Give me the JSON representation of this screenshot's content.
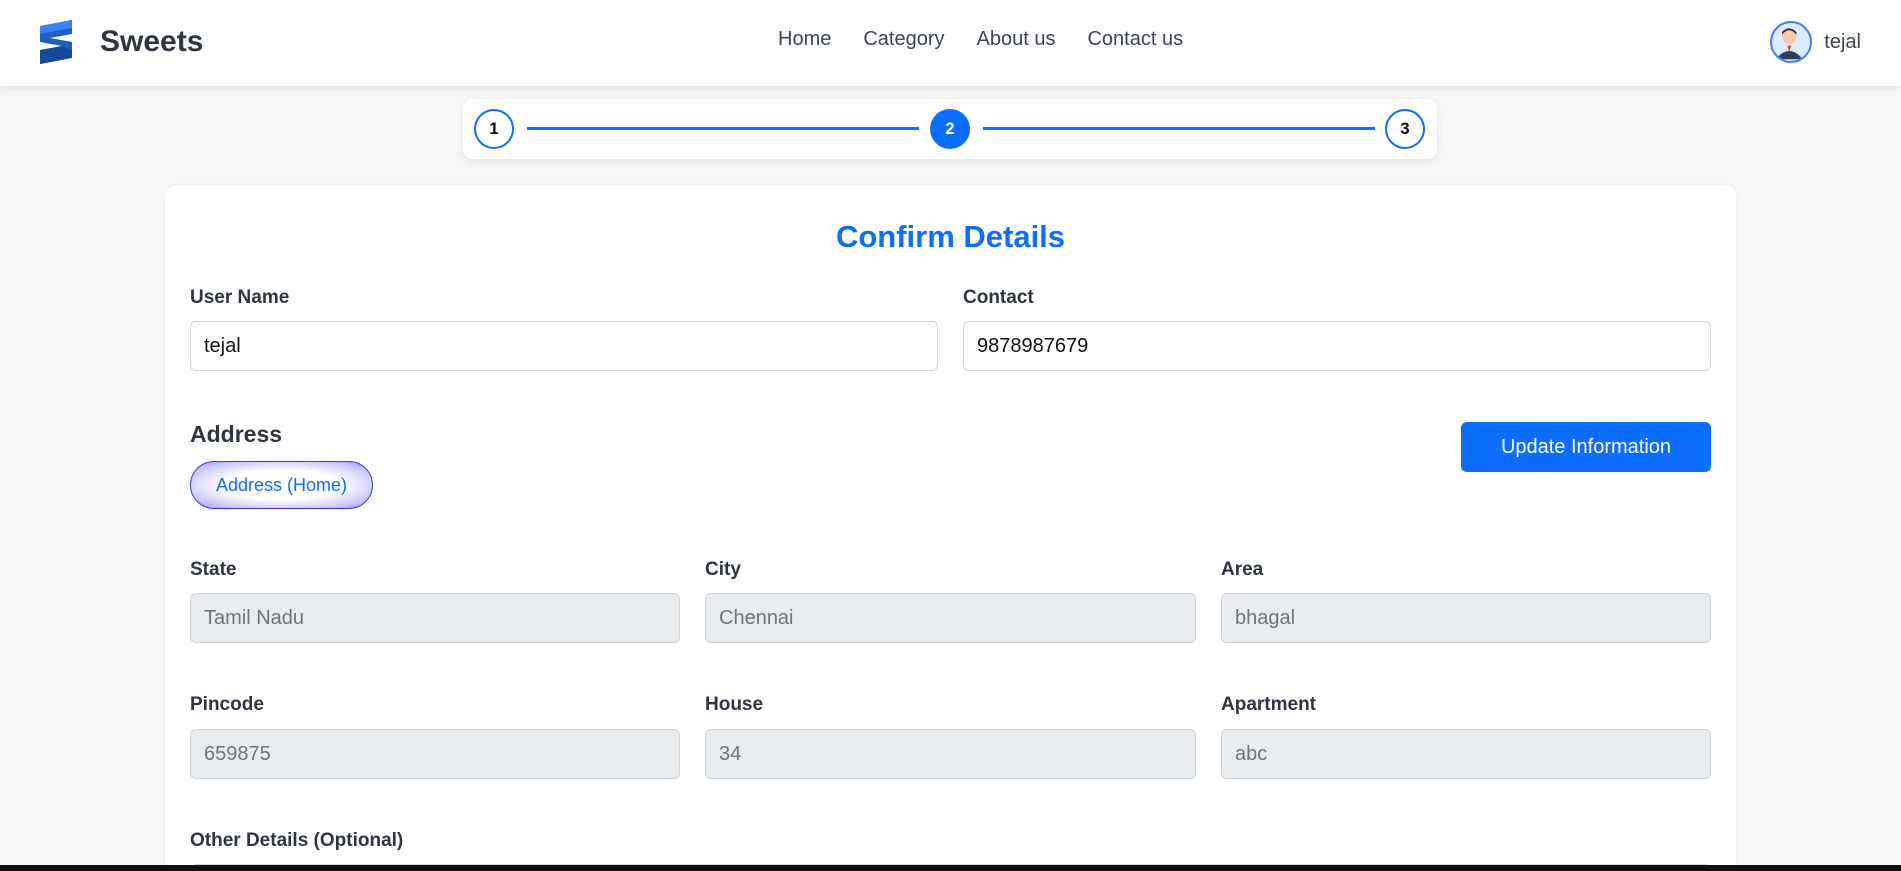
{
  "navbar": {
    "brand_name": "Sweets",
    "links": [
      "Home",
      "Category",
      "About us",
      "Contact us"
    ],
    "user_name": "tejal"
  },
  "stepper": {
    "steps": [
      "1",
      "2",
      "3"
    ],
    "active_step": 2,
    "accent": "#0d6efd"
  },
  "form": {
    "title": "Confirm Details",
    "user_name_label": "User Name",
    "user_name_value": "tejal",
    "contact_label": "Contact",
    "contact_value": "9878987679",
    "address_heading": "Address",
    "address_pill": "Address (Home)",
    "update_button": "Update Information",
    "state_label": "State",
    "state_value": "Tamil Nadu",
    "city_label": "City",
    "city_value": "Chennai",
    "area_label": "Area",
    "area_value": "bhagal",
    "pincode_label": "Pincode",
    "pincode_value": "659875",
    "house_label": "House",
    "house_value": "34",
    "apartment_label": "Apartment",
    "apartment_value": "abc",
    "other_details_label": "Other Details (Optional)"
  }
}
